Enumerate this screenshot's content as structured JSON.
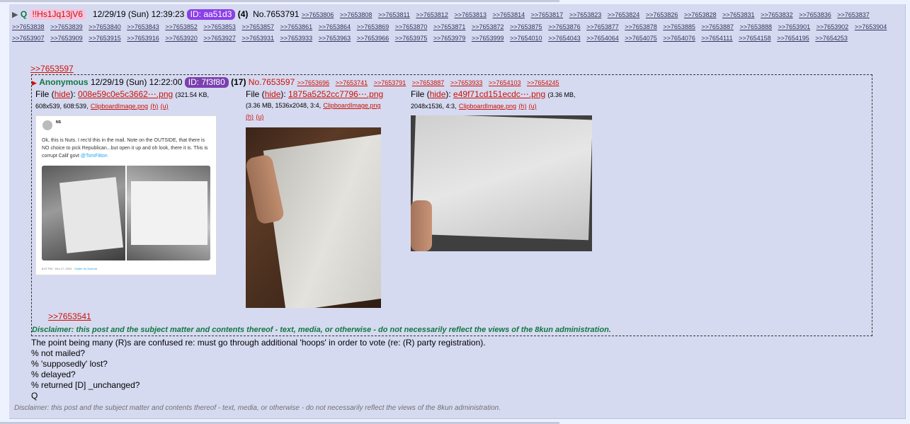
{
  "post": {
    "toggle": "▶",
    "name": "Q",
    "tripcode": "!!Hs1Jq13jV6",
    "datetime": "12/29/19 (Sun) 12:39:23",
    "id_label": "ID: aa51d3",
    "id_count": "(4)",
    "number": "No.7653791",
    "backlinks": [
      ">>7653806",
      ">>7653808",
      ">>7653811",
      ">>7653812",
      ">>7653813",
      ">>7653814",
      ">>7653817",
      ">>7653823",
      ">>7653824",
      ">>7653826",
      ">>7653828",
      ">>7653831",
      ">>7653832",
      ">>7653836",
      ">>7653837",
      ">>7653838",
      ">>7653839",
      ">>7653840",
      ">>7653843",
      ">>7653852",
      ">>7653853",
      ">>7653857",
      ">>7653861",
      ">>7653864",
      ">>7653869",
      ">>7653870",
      ">>7653871",
      ">>7653872",
      ">>7653875",
      ">>7653876",
      ">>7653877",
      ">>7653878",
      ">>7653885",
      ">>7653887",
      ">>7653888",
      ">>7653901",
      ">>7653902",
      ">>7653904",
      ">>7653907",
      ">>7653909",
      ">>7653915",
      ">>7653916",
      ">>7653920",
      ">>7653927",
      ">>7653931",
      ">>7653933",
      ">>7653963",
      ">>7653966",
      ">>7653975",
      ">>7653979",
      ">>7653999",
      ">>7654010",
      ">>7654043",
      ">>7654064",
      ">>7654075",
      ">>7654076",
      ">>7654111",
      ">>7654158",
      ">>7654195",
      ">>7654253"
    ],
    "quote_link": ">>7653597",
    "body": [
      "The point being many (R)s are confused re: must go through additional 'hoops' in order to vote (re: (R) party registration).",
      "% not mailed?",
      "% 'supposedly' lost?",
      "% delayed?",
      "% returned [D] _unchanged?",
      "Q"
    ],
    "disclaimer": "Disclaimer: this post and the subject matter and contents thereof - text, media, or otherwise - do not necessarily reflect the views of the 8kun administration."
  },
  "quoted": {
    "name": "Anonymous",
    "datetime": "12/29/19 (Sun) 12:22:00",
    "id_label": "ID: 7f3f80",
    "id_count": "(17)",
    "number": "No.7653597",
    "backlinks": [
      ">>7653696",
      ">>7653741",
      ">>7653791",
      ">>7653887",
      ">>7653933",
      ">>7654103",
      ">>7654245"
    ],
    "files": [
      {
        "label": "File",
        "hide": "hide",
        "name": "008e59c0e5c3662⋯.png",
        "meta1": "(321.54 KB,",
        "meta2": "608x539, 608:539,",
        "orig": "ClipboardImage.png",
        "h": "(h)",
        "u": "(u)"
      },
      {
        "label": "File",
        "hide": "hide",
        "name": "1875a5252cc7796⋯.png",
        "meta1": "(3.36 MB, 1536x2048, 3:4,",
        "orig": "ClipboardImage.png",
        "h": "(h)",
        "u": "(u)"
      },
      {
        "label": "File",
        "hide": "hide",
        "name": "e49f71cd151ecdc⋯.png",
        "meta1": "(3.36 MB,",
        "meta2": "2048x1536, 4:3,",
        "orig": "ClipboardImage.png",
        "h": "(h)",
        "u": "(u)"
      }
    ],
    "tweet": {
      "handle": "NS",
      "text": "Ok, this is Nuts. I rec'd this in the mail. Note on the OUTSIDE, that there is NO choice to pick Republican...but open it up and oh look, there it is. This is corrupt Calif govt",
      "mention": "@TomFitton",
      "footer": "8:57 PM · Dec 17, 2019 ·",
      "footer_link": "Twitter for Android"
    },
    "inner_quote": ">>7653541",
    "disclaimer": "Disclaimer: this post and the subject matter and contents thereof - text, media, or otherwise - do not necessarily reflect the views of the 8kun administration."
  }
}
